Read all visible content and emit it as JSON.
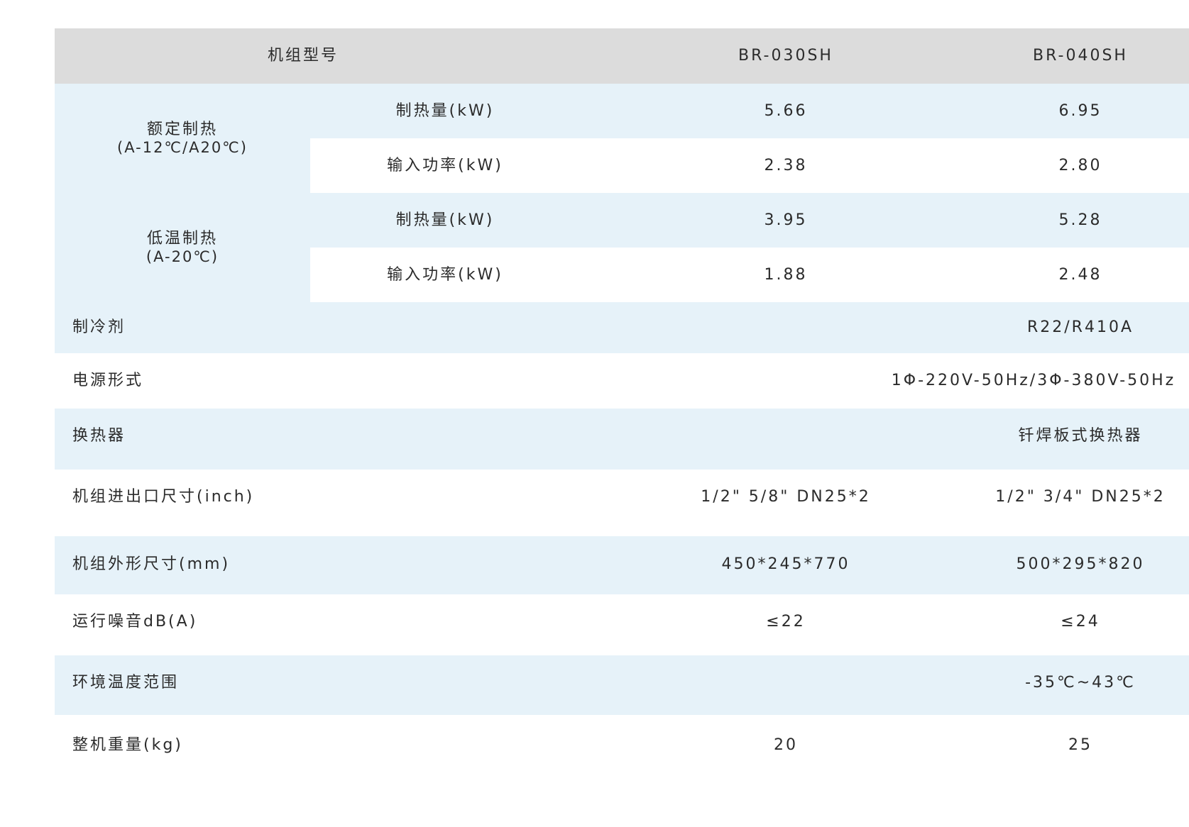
{
  "table": {
    "header": {
      "label": "机组型号",
      "model_a": "BR-030SH",
      "model_b": "BR-040SH"
    },
    "rated_heating": {
      "label": "额定制热",
      "condition": "(A-12℃/A20℃)",
      "capacity": {
        "label": "制热量(kW)",
        "a": "5.66",
        "b": "6.95"
      },
      "power": {
        "label": "输入功率(kW)",
        "a": "2.38",
        "b": "2.80"
      }
    },
    "low_temp_heating": {
      "label": "低温制热",
      "condition": "(A-20℃)",
      "capacity": {
        "label": "制热量(kW)",
        "a": "3.95",
        "b": "5.28"
      },
      "power": {
        "label": "输入功率(kW)",
        "a": "1.88",
        "b": "2.48"
      }
    },
    "refrigerant": {
      "label": "制冷剂",
      "value": "R22/R410A"
    },
    "power_supply": {
      "label": "电源形式",
      "value": "1Φ-220V-50Hz/3Φ-380V-50Hz"
    },
    "heat_exchanger": {
      "label": "换热器",
      "value": "钎焊板式换热器"
    },
    "port_size": {
      "label": "机组进出口尺寸(inch)",
      "a": "1/2\" 5/8\" DN25*2",
      "b": "1/2\"  3/4\"  DN25*2"
    },
    "dimensions": {
      "label": "机组外形尺寸(mm)",
      "a": "450*245*770",
      "b": "500*295*820"
    },
    "noise": {
      "label": "运行噪音dB(A)",
      "a": "≤22",
      "b": "≤24"
    },
    "ambient_range": {
      "label": "环境温度范围",
      "value": "-35℃~43℃"
    },
    "weight": {
      "label": "整机重量(kg)",
      "a": "20",
      "b": "25"
    }
  },
  "colors": {
    "header_bg": "#dcdcdc",
    "row_blue": "#e6f2f9",
    "row_white": "#ffffff",
    "text": "#2b2b2b"
  }
}
